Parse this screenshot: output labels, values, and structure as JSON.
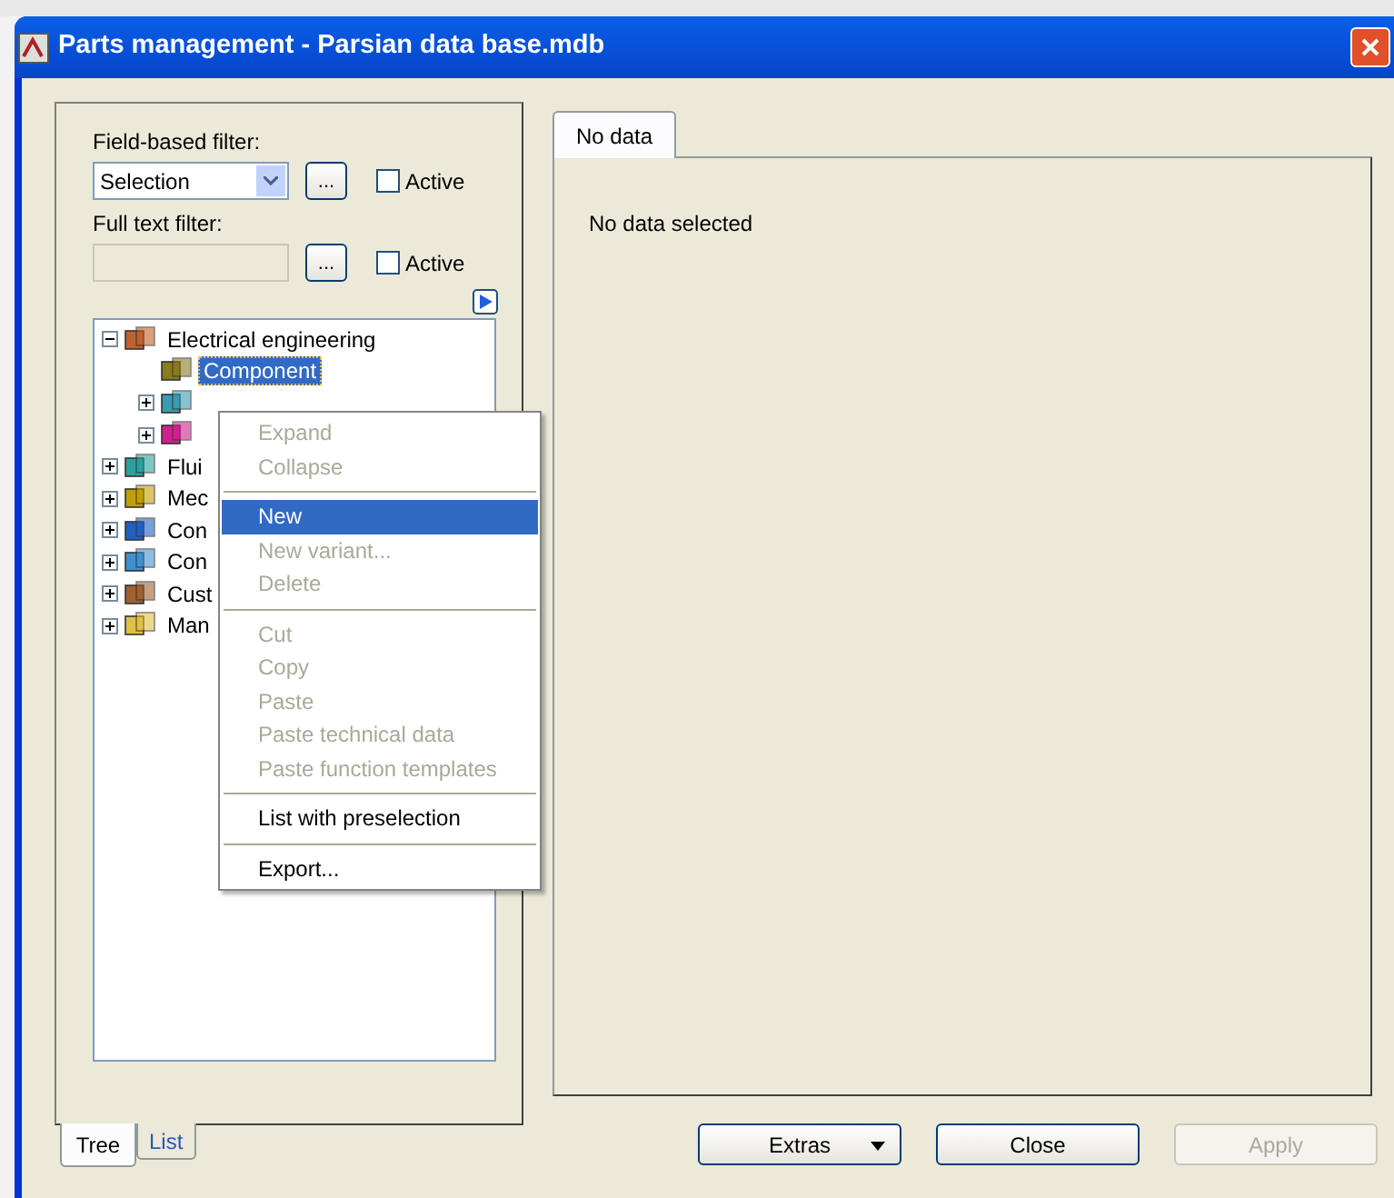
{
  "window": {
    "title": "Parts management - Parsian data base.mdb"
  },
  "filters": [
    {
      "label": "Field-based filter:",
      "kind": "combo",
      "value": "Selection",
      "button": "...",
      "active_label": "Active",
      "checked": false
    },
    {
      "label": "Full text filter:",
      "kind": "text",
      "disabled": true,
      "button": "...",
      "active_label": "Active",
      "checked": false
    }
  ],
  "tree": [
    {
      "label": "Electrical engineering",
      "expanded": true,
      "children": [
        {
          "label": "Component",
          "selected": true
        },
        {
          "expanded": false
        },
        {
          "expanded": false
        }
      ]
    },
    {
      "label": "Flui",
      "expanded": false
    },
    {
      "label": "Mec",
      "expanded": false
    },
    {
      "label": "Con",
      "expanded": false
    },
    {
      "label": "Con",
      "expanded": false
    },
    {
      "label": "Cust",
      "expanded": false
    },
    {
      "label": "Man",
      "expanded": false
    }
  ],
  "context_menu": [
    {
      "kind": "item",
      "label": "Expand",
      "disabled": true,
      "selected": false
    },
    {
      "kind": "item",
      "label": "Collapse",
      "disabled": true,
      "selected": false
    },
    {
      "kind": "separator"
    },
    {
      "kind": "item",
      "label": "New",
      "disabled": false,
      "selected": true
    },
    {
      "kind": "item",
      "label": "New variant...",
      "disabled": true,
      "selected": false
    },
    {
      "kind": "item",
      "label": "Delete",
      "disabled": true,
      "selected": false
    },
    {
      "kind": "separator"
    },
    {
      "kind": "item",
      "label": "Cut",
      "disabled": true,
      "selected": false
    },
    {
      "kind": "item",
      "label": "Copy",
      "disabled": true,
      "selected": false
    },
    {
      "kind": "item",
      "label": "Paste",
      "disabled": true,
      "selected": false
    },
    {
      "kind": "item",
      "label": "Paste technical data",
      "disabled": true,
      "selected": false
    },
    {
      "kind": "item",
      "label": "Paste function templates",
      "disabled": true,
      "selected": false
    },
    {
      "kind": "separator"
    },
    {
      "kind": "item",
      "label": "List with preselection",
      "disabled": false,
      "selected": false
    },
    {
      "kind": "separator"
    },
    {
      "kind": "item",
      "label": "Export...",
      "disabled": false,
      "selected": false
    }
  ],
  "left_tabs": [
    {
      "label": "Tree",
      "selected": true
    },
    {
      "label": "List",
      "selected": false
    }
  ],
  "right_tabs": [
    {
      "label": "No data",
      "selected": true
    }
  ],
  "detail": {
    "message": "No data selected"
  },
  "buttons": [
    {
      "label": "Extras",
      "dropdown": true,
      "disabled": false
    },
    {
      "label": "Close",
      "dropdown": false,
      "disabled": false
    },
    {
      "label": "Apply",
      "dropdown": false,
      "disabled": true
    }
  ]
}
